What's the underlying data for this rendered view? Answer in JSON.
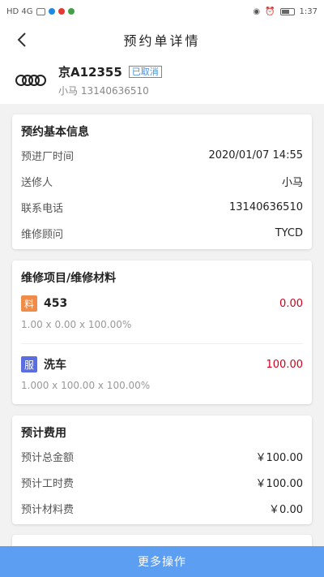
{
  "status_bar": {
    "left_text": "HD 4G",
    "time": "1:37",
    "colors": {
      "red": "#e53935",
      "blue": "#1e88e5",
      "green": "#43a047"
    }
  },
  "nav": {
    "title": "预约单详情",
    "back_icon": "chevron-left-icon"
  },
  "car": {
    "plate": "京A12355",
    "status": "已取消",
    "owner": "小马 13140636510",
    "logo_icon": "audi-rings-logo"
  },
  "basic_info": {
    "title": "预约基本信息",
    "rows": [
      {
        "label": "预进厂时间",
        "value": "2020/01/07 14:55"
      },
      {
        "label": "送修人",
        "value": "小马"
      },
      {
        "label": "联系电话",
        "value": "13140636510"
      },
      {
        "label": "维修顾问",
        "value": "TYCD"
      }
    ]
  },
  "repair": {
    "title": "维修项目/维修材料",
    "items": [
      {
        "tag": "料",
        "tag_color": "#f08c4a",
        "name": "453",
        "price": "0.00",
        "formula": "1.00 x 0.00 x 100.00%"
      },
      {
        "tag": "服",
        "tag_color": "#5b6ee1",
        "name": "洗车",
        "price": "100.00",
        "formula": "1.000 x 100.00 x 100.00%"
      }
    ]
  },
  "cost": {
    "title": "预计费用",
    "rows": [
      {
        "label": "预计总金额",
        "value": "￥100.00"
      },
      {
        "label": "预计工时费",
        "value": "￥100.00"
      },
      {
        "label": "预计材料费",
        "value": "￥0.00"
      }
    ]
  },
  "bottom": {
    "button_label": "更多操作",
    "button_color": "#5b9ef2"
  }
}
